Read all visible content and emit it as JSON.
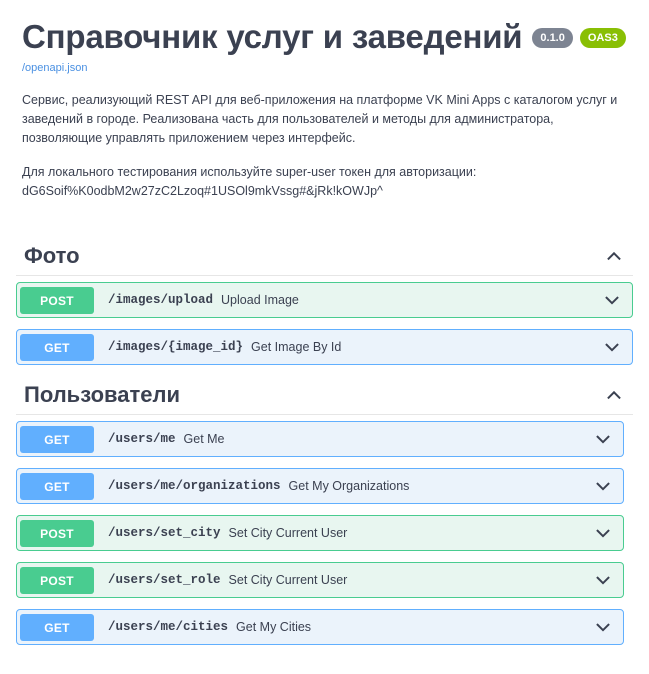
{
  "header": {
    "title": "Справочник услуг и заведений",
    "version_badge": "0.1.0",
    "oas_badge": "OAS3",
    "spec_link": "/openapi.json"
  },
  "description": {
    "paragraph1": "Сервис, реализующий REST API для веб-приложения на платформе VK Mini Apps с каталогом услуг и заведений в городе. Реализована часть для пользователей и методы для администратора, позволяющие управлять приложением через интерфейс.",
    "paragraph2_intro": "Для локального тестирования используйте super-user токен для авторизации:",
    "token": "dG6Soif%K0odbM2w27zC2Lzoq#1USOl9mkVssg#&jRk!kOWJp^"
  },
  "colors": {
    "get": "#61affe",
    "post": "#49cc90",
    "oas_badge_bg": "#89bf04",
    "version_badge_bg": "#7d8492",
    "text": "#3b4151",
    "link": "#4a90e2"
  },
  "sections": [
    {
      "name": "Фото",
      "collapse_icon": "chevron-up-icon",
      "operations": [
        {
          "method": "POST",
          "method_class": "post",
          "row_class": "op-post",
          "path": "/images/upload",
          "summary": "Upload Image",
          "toggle_icon": "chevron-down-icon"
        },
        {
          "method": "GET",
          "method_class": "get",
          "row_class": "op-get",
          "path": "/images/{image_id}",
          "summary": "Get Image By Id",
          "toggle_icon": "chevron-down-icon"
        }
      ]
    },
    {
      "name": "Пользователи",
      "collapse_icon": "chevron-up-icon",
      "operations": [
        {
          "method": "GET",
          "method_class": "get",
          "row_class": "op-get",
          "path": "/users/me",
          "summary": "Get Me",
          "toggle_icon": "chevron-down-icon"
        },
        {
          "method": "GET",
          "method_class": "get",
          "row_class": "op-get",
          "path": "/users/me/organizations",
          "summary": "Get My Organizations",
          "toggle_icon": "chevron-down-icon"
        },
        {
          "method": "POST",
          "method_class": "post",
          "row_class": "op-post",
          "path": "/users/set_city",
          "summary": "Set City Current User",
          "toggle_icon": "chevron-down-icon"
        },
        {
          "method": "POST",
          "method_class": "post",
          "row_class": "op-post",
          "path": "/users/set_role",
          "summary": "Set City Current User",
          "toggle_icon": "chevron-down-icon"
        },
        {
          "method": "GET",
          "method_class": "get",
          "row_class": "op-get",
          "path": "/users/me/cities",
          "summary": "Get My Cities",
          "toggle_icon": "chevron-down-icon"
        }
      ]
    }
  ]
}
